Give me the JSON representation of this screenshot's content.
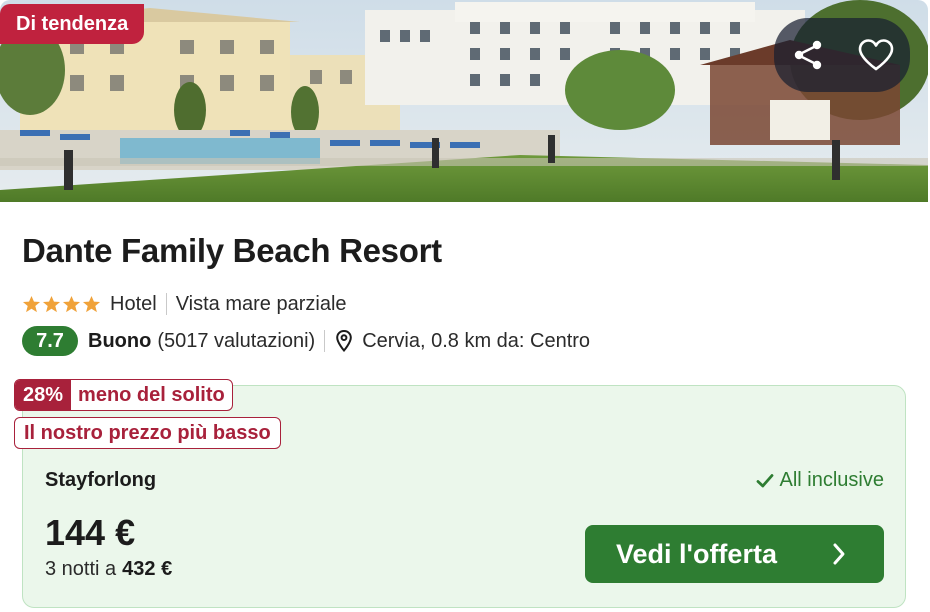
{
  "hero": {
    "badge": "Di tendenza",
    "share_icon": "share-icon",
    "favorite_icon": "heart-icon"
  },
  "hotel": {
    "name": "Dante Family Beach Resort",
    "stars": 4,
    "type": "Hotel",
    "feature": "Vista mare parziale",
    "score": "7.7",
    "rating_word": "Buono",
    "reviews": "(5017 valutazioni)",
    "location": "Cervia, 0.8 km da: Centro"
  },
  "deal": {
    "discount_pct": "28%",
    "discount_text": "meno del solito",
    "lowest_price_text": "Il nostro prezzo più basso",
    "provider": "Stayforlong",
    "board": "All inclusive",
    "price": "144 €",
    "nights_text": "3 notti a",
    "total": "432 €",
    "cta": "Vedi l'offerta"
  },
  "colors": {
    "brand_green": "#2e7d32",
    "trend_red": "#c0223e",
    "deal_red": "#a8213b",
    "deal_bg": "#ebf7eb",
    "star": "#f0a23a"
  }
}
